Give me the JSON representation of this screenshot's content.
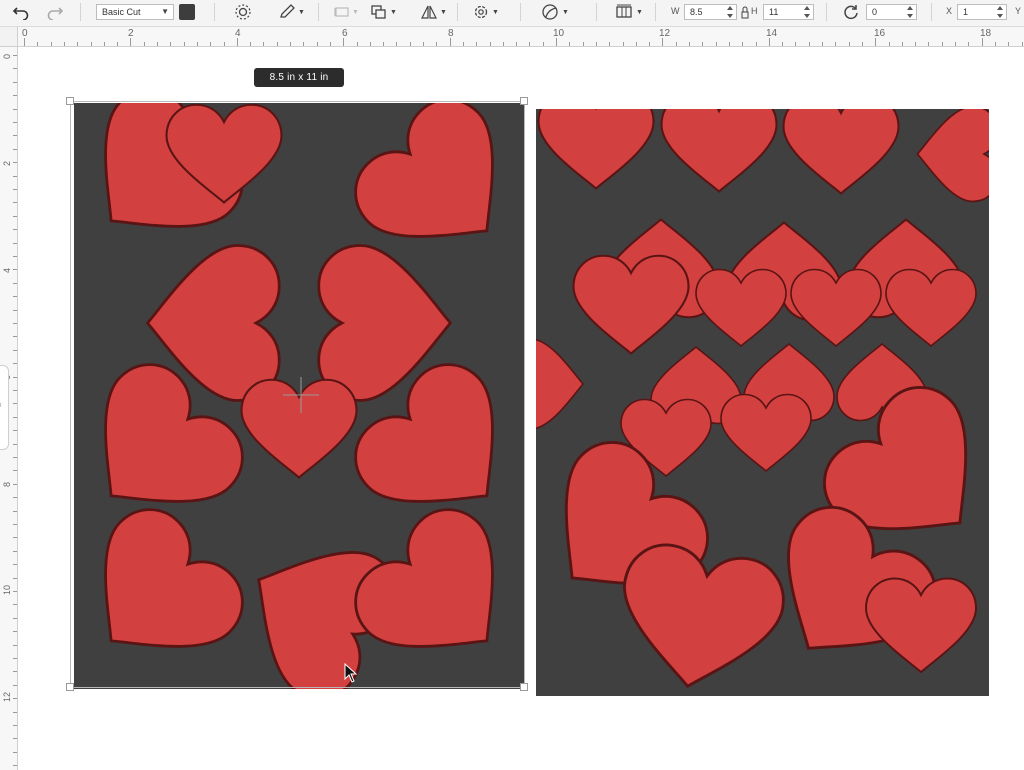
{
  "toolbar": {
    "undo_icon": "undo-icon",
    "redo_icon": "redo-icon",
    "operation_value": "Basic Cut",
    "color": "#3d3d3d",
    "width_label": "W",
    "width_value": "8.5",
    "height_label": "H",
    "height_value": "11",
    "rotate_value": "0",
    "x_label": "X",
    "x_value": "1",
    "y_label": "Y"
  },
  "ruler": {
    "top": [
      "0",
      "2",
      "4",
      "6",
      "8",
      "10",
      "12",
      "14",
      "16",
      "18"
    ],
    "left": [
      "0",
      "2",
      "4",
      "6",
      "8",
      "10",
      "12"
    ]
  },
  "canvas": {
    "size_tooltip": "8.5  in x 11  in",
    "page_color": "#404040",
    "heart_color": "#d24040"
  }
}
